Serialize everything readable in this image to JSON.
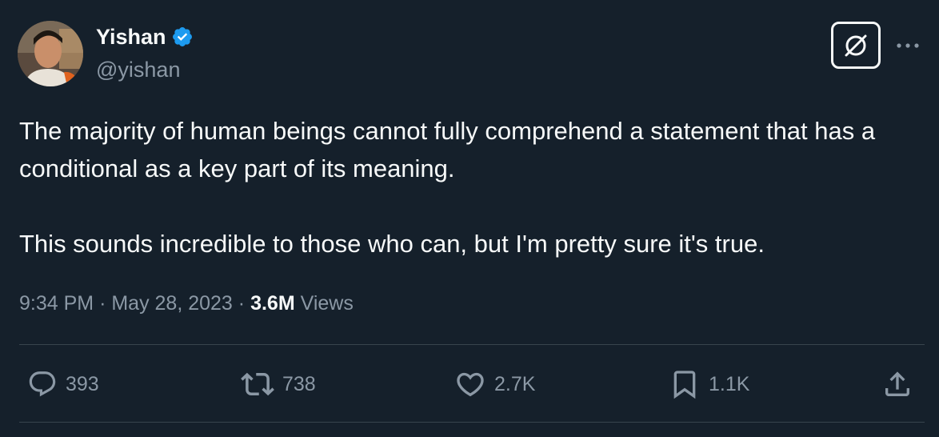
{
  "author": {
    "name": "Yishan",
    "handle": "@yishan",
    "verified": true,
    "verified_color": "#1d9bf0"
  },
  "tweet": {
    "paragraphs": [
      "The majority of human beings cannot fully comprehend a statement that has a conditional as a key part of its meaning.",
      "This sounds incredible to those who can, but I'm pretty sure it's true."
    ],
    "time": "9:34 PM",
    "separator": "·",
    "date": "May 28, 2023",
    "views_count": "3.6M",
    "views_label": "Views"
  },
  "actions": {
    "replies": "393",
    "reposts": "738",
    "likes": "2.7K",
    "bookmarks": "1.1K"
  },
  "icons": {
    "grok": "grok-icon",
    "more": "more-icon",
    "reply": "reply-icon",
    "repost": "repost-icon",
    "like": "heart-icon",
    "bookmark": "bookmark-icon",
    "share": "share-icon"
  },
  "colors": {
    "background": "#15202b",
    "text": "#f7f9f9",
    "secondary": "#8b98a5",
    "divider": "#38444d"
  }
}
